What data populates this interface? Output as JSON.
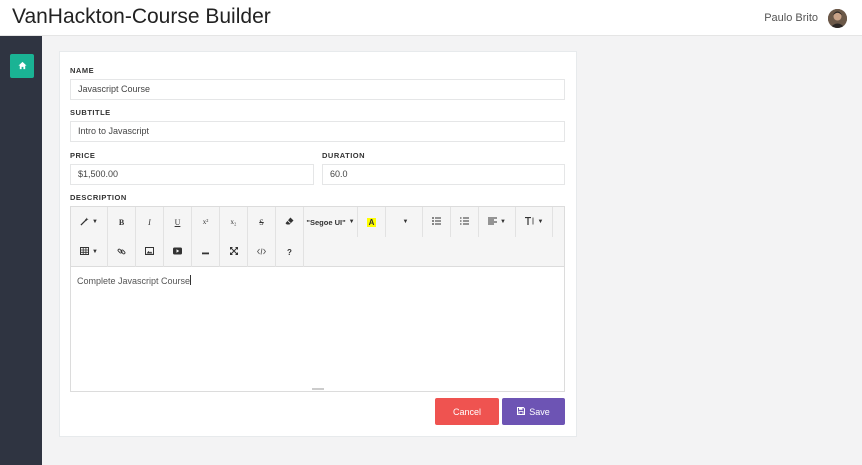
{
  "header": {
    "title": "VanHackton-Course Builder",
    "user_name": "Paulo Brito"
  },
  "sidebar": {
    "items": [
      {
        "icon": "home-icon",
        "color": "#1ab394"
      }
    ]
  },
  "form": {
    "name": {
      "label": "NAME",
      "value": "Javascript Course"
    },
    "subtitle": {
      "label": "SUBTITLE",
      "value": "Intro to Javascript"
    },
    "price": {
      "label": "PRICE",
      "value": "$1,500.00"
    },
    "duration": {
      "label": "DURATION",
      "value": "60.0"
    },
    "description": {
      "label": "DESCRIPTION",
      "content": "Complete Javascript Course",
      "toolbar": {
        "font_family": "\"Segoe UI\"",
        "bold": "B",
        "italic": "I",
        "underline": "U",
        "superscript": "x²",
        "subscript": "x₂",
        "strikethrough": "S",
        "color_letter": "A",
        "help": "?"
      }
    }
  },
  "actions": {
    "cancel_label": "Cancel",
    "save_label": "Save"
  },
  "colors": {
    "accent": "#1ab394",
    "cancel": "#ef5350",
    "save": "#6d54b4",
    "sidebar": "#2f3441"
  }
}
